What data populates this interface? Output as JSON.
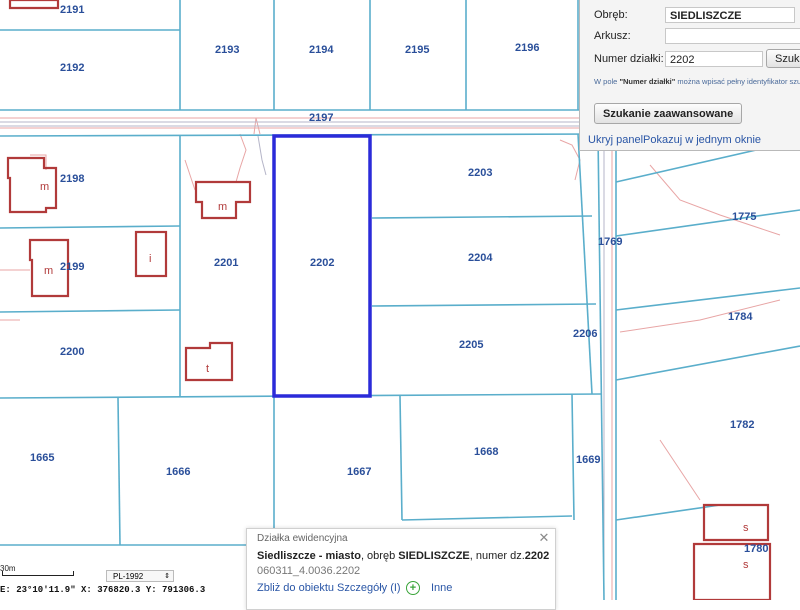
{
  "map": {
    "plots": [
      {
        "name": "plot-2191",
        "label": "2191"
      },
      {
        "name": "plot-2192",
        "label": "2192"
      },
      {
        "name": "plot-2193",
        "label": "2193"
      },
      {
        "name": "plot-2194",
        "label": "2194"
      },
      {
        "name": "plot-2195",
        "label": "2195"
      },
      {
        "name": "plot-2196",
        "label": "2196"
      },
      {
        "name": "plot-2197",
        "label": "2197"
      },
      {
        "name": "plot-2198",
        "label": "2198"
      },
      {
        "name": "plot-2199",
        "label": "2199"
      },
      {
        "name": "plot-2200",
        "label": "2200"
      },
      {
        "name": "plot-2201",
        "label": "2201"
      },
      {
        "name": "plot-2202",
        "label": "2202"
      },
      {
        "name": "plot-2203",
        "label": "2203"
      },
      {
        "name": "plot-2204",
        "label": "2204"
      },
      {
        "name": "plot-2205",
        "label": "2205"
      },
      {
        "name": "plot-2206",
        "label": "2206"
      },
      {
        "name": "plot-1665",
        "label": "1665"
      },
      {
        "name": "plot-1666",
        "label": "1666"
      },
      {
        "name": "plot-1667",
        "label": "1667"
      },
      {
        "name": "plot-1668",
        "label": "1668"
      },
      {
        "name": "plot-1669",
        "label": "1669"
      },
      {
        "name": "plot-1769",
        "label": "1769"
      },
      {
        "name": "plot-1775",
        "label": "1775"
      },
      {
        "name": "plot-1784",
        "label": "1784"
      },
      {
        "name": "plot-1782",
        "label": "1782"
      },
      {
        "name": "plot-1780",
        "label": "1780"
      }
    ],
    "buildings": [
      {
        "name": "building-2198",
        "label": "m"
      },
      {
        "name": "building-2199",
        "label": "m"
      },
      {
        "name": "building-i",
        "label": "i"
      },
      {
        "name": "building-2201",
        "label": "m"
      },
      {
        "name": "building-t",
        "label": "t"
      },
      {
        "name": "building-s-upper",
        "label": "s"
      },
      {
        "name": "building-s-lower",
        "label": "s"
      }
    ],
    "highlight_color": "#2b2bd9",
    "boundary_color": "#5aaecb",
    "building_color": "#b13a3a"
  },
  "search": {
    "obreb_label": "Obręb:",
    "obreb_value": "SIEDLISZCZE",
    "arkusz_label": "Arkusz:",
    "arkusz_value": "",
    "numer_label": "Numer działki:",
    "numer_value": "2202",
    "search_button": "Szukaj",
    "hint_prefix": "W pole ",
    "hint_bold": "\"Numer działki\"",
    "hint_suffix": " można wpisać pełny identyfikator szu",
    "advanced_button": "Szukanie zaawansowane",
    "hide_panel_link": "Ukryj panel",
    "single_window_link": "Pokazuj w jednym oknie"
  },
  "popup": {
    "title": "Działka ewidencyjna",
    "locality": "Siedliszcze - miasto",
    "obreb_text": ", obręb ",
    "obreb": "SIEDLISZCZE",
    "numer_text": ", numer dz.",
    "numer": "2202",
    "identifier": "060311_4.0036.2202",
    "zoom_link": "Zbliż do obiektu",
    "details_link": "Szczegóły (I)",
    "other_link": "Inne"
  },
  "status": {
    "scale_label": "30m",
    "crs": "PL-1992",
    "coords": "E: 23°10′11.9″  X: 376820.3  Y: 791306.3"
  }
}
